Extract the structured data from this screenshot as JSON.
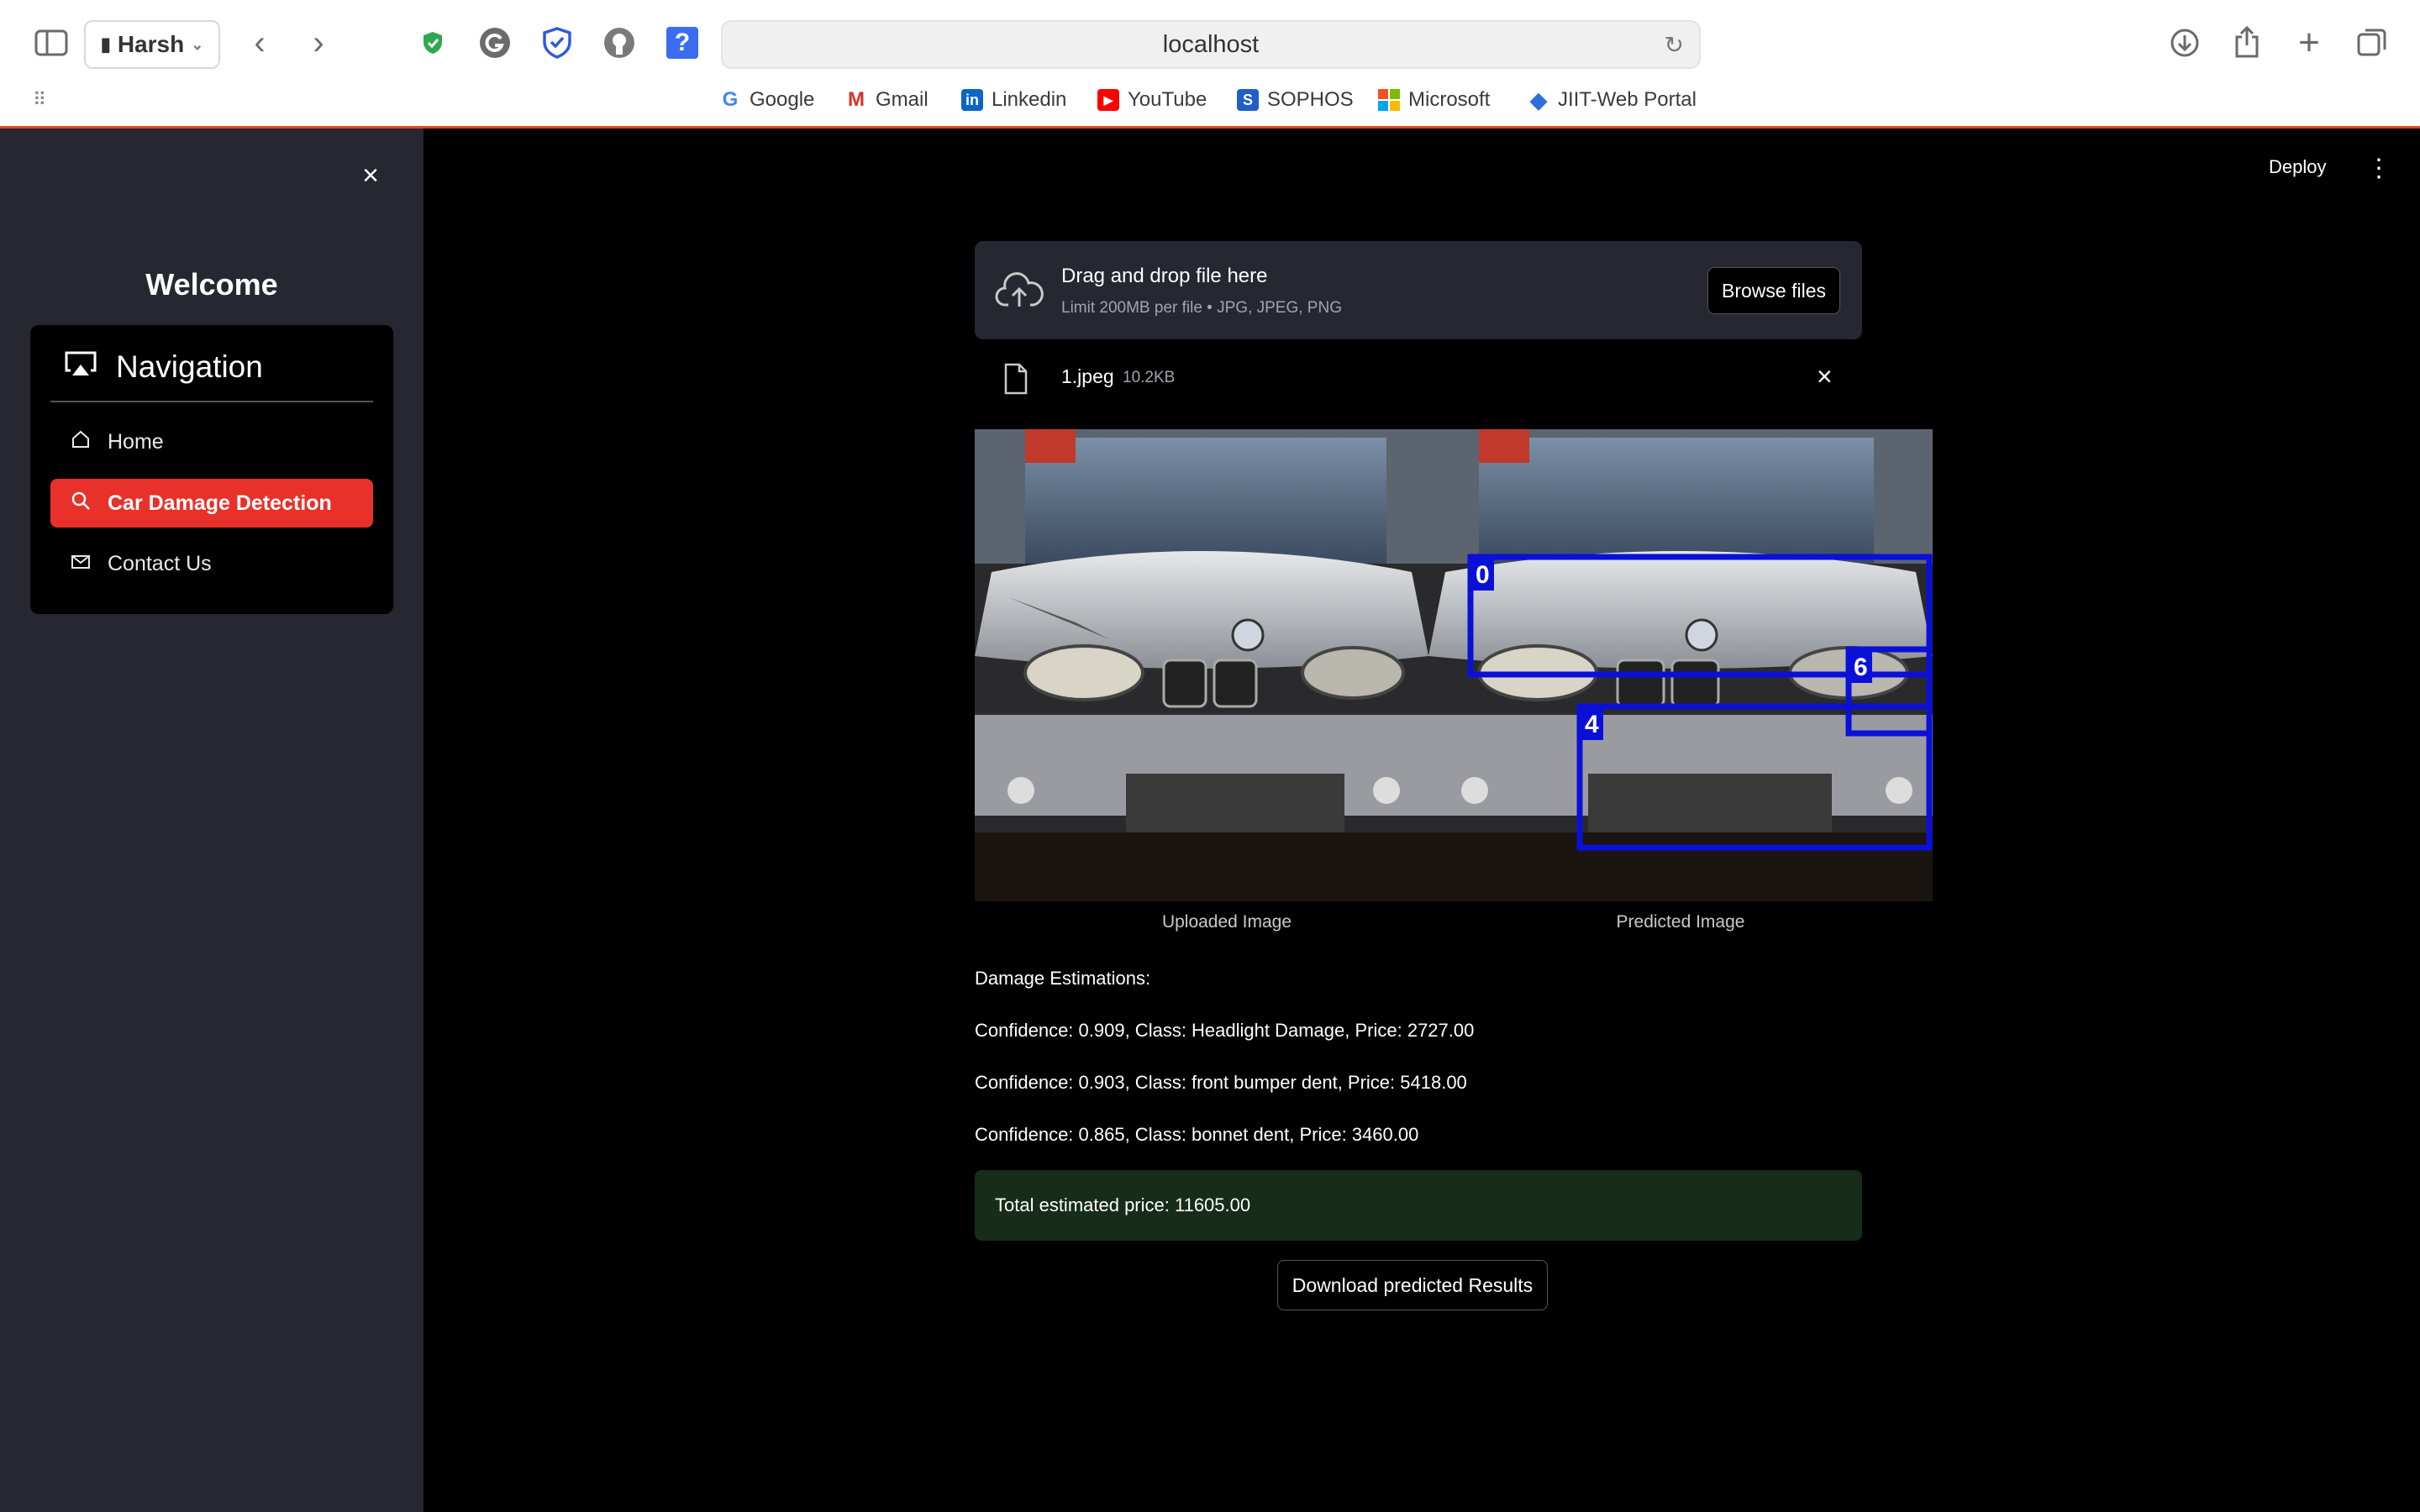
{
  "browser": {
    "profile_name": "Harsh",
    "url": "localhost",
    "bookmarks": [
      {
        "label": "Google",
        "icon": "google-icon"
      },
      {
        "label": "Gmail",
        "icon": "gmail-icon"
      },
      {
        "label": "Linkedin",
        "icon": "linkedin-icon"
      },
      {
        "label": "YouTube",
        "icon": "youtube-icon"
      },
      {
        "label": "SOPHOS",
        "icon": "sophos-icon"
      },
      {
        "label": "Microsoft",
        "icon": "microsoft-icon"
      },
      {
        "label": "JIIT-Web Portal",
        "icon": "jiit-icon"
      }
    ]
  },
  "sidebar": {
    "welcome": "Welcome",
    "nav_title": "Navigation",
    "items": [
      {
        "label": "Home",
        "icon": "home-icon",
        "active": false
      },
      {
        "label": "Car Damage Detection",
        "icon": "search-icon",
        "active": true
      },
      {
        "label": "Contact Us",
        "icon": "envelope-icon",
        "active": false
      }
    ],
    "accent_color": "#e8312a"
  },
  "header": {
    "deploy_label": "Deploy"
  },
  "uploader": {
    "title": "Drag and drop file here",
    "subtitle": "Limit 200MB per file • JPG, JPEG, PNG",
    "browse_label": "Browse files",
    "file_name": "1.jpeg",
    "file_size": "10.2KB"
  },
  "images": {
    "uploaded_caption": "Uploaded Image",
    "predicted_caption": "Predicted Image",
    "box_labels": [
      "0",
      "4",
      "6"
    ],
    "box_color": "#0a10d8"
  },
  "results": {
    "heading": "Damage Estimations:",
    "lines": [
      "Confidence: 0.909, Class: Headlight Damage, Price: 2727.00",
      "Confidence: 0.903, Class: front bumper dent, Price: 5418.00",
      "Confidence: 0.865, Class: bonnet dent, Price: 3460.00"
    ],
    "total": "Total estimated price: 11605.00",
    "download_label": "Download predicted Results"
  }
}
